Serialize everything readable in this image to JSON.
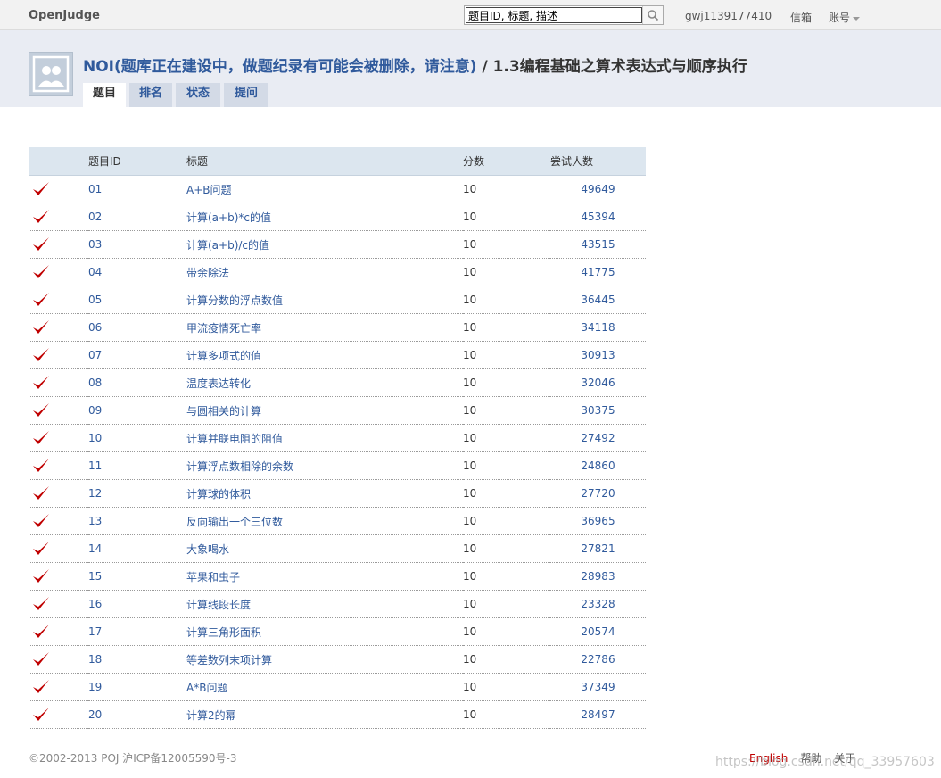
{
  "topbar": {
    "brand": "OpenJudge",
    "search_value": "题目ID, 标题, 描述",
    "user": "gwj1139177410",
    "inbox": "信箱",
    "account": "账号"
  },
  "header": {
    "group_title": "NOI(题库正在建设中，做题纪录有可能会被删除，请注意)",
    "separator": " / ",
    "section_title": "1.3编程基础之算术表达式与顺序执行",
    "tabs": [
      {
        "label": "题目",
        "active": true
      },
      {
        "label": "排名",
        "active": false
      },
      {
        "label": "状态",
        "active": false
      },
      {
        "label": "提问",
        "active": false
      }
    ]
  },
  "table": {
    "columns": [
      "",
      "题目ID",
      "标题",
      "分数",
      "尝试人数"
    ],
    "rows": [
      {
        "solved": true,
        "id": "01",
        "title": "A+B问题",
        "score": "10",
        "tries": "49649"
      },
      {
        "solved": true,
        "id": "02",
        "title": "计算(a+b)*c的值",
        "score": "10",
        "tries": "45394"
      },
      {
        "solved": true,
        "id": "03",
        "title": "计算(a+b)/c的值",
        "score": "10",
        "tries": "43515"
      },
      {
        "solved": true,
        "id": "04",
        "title": "带余除法",
        "score": "10",
        "tries": "41775"
      },
      {
        "solved": true,
        "id": "05",
        "title": "计算分数的浮点数值",
        "score": "10",
        "tries": "36445"
      },
      {
        "solved": true,
        "id": "06",
        "title": "甲流疫情死亡率",
        "score": "10",
        "tries": "34118"
      },
      {
        "solved": true,
        "id": "07",
        "title": "计算多项式的值",
        "score": "10",
        "tries": "30913"
      },
      {
        "solved": true,
        "id": "08",
        "title": "温度表达转化",
        "score": "10",
        "tries": "32046"
      },
      {
        "solved": true,
        "id": "09",
        "title": "与圆相关的计算",
        "score": "10",
        "tries": "30375"
      },
      {
        "solved": true,
        "id": "10",
        "title": "计算并联电阻的阻值",
        "score": "10",
        "tries": "27492"
      },
      {
        "solved": true,
        "id": "11",
        "title": "计算浮点数相除的余数",
        "score": "10",
        "tries": "24860"
      },
      {
        "solved": true,
        "id": "12",
        "title": "计算球的体积",
        "score": "10",
        "tries": "27720"
      },
      {
        "solved": true,
        "id": "13",
        "title": "反向输出一个三位数",
        "score": "10",
        "tries": "36965"
      },
      {
        "solved": true,
        "id": "14",
        "title": "大象喝水",
        "score": "10",
        "tries": "27821"
      },
      {
        "solved": true,
        "id": "15",
        "title": "苹果和虫子",
        "score": "10",
        "tries": "28983"
      },
      {
        "solved": true,
        "id": "16",
        "title": "计算线段长度",
        "score": "10",
        "tries": "23328"
      },
      {
        "solved": true,
        "id": "17",
        "title": "计算三角形面积",
        "score": "10",
        "tries": "20574"
      },
      {
        "solved": true,
        "id": "18",
        "title": "等差数列末项计算",
        "score": "10",
        "tries": "22786"
      },
      {
        "solved": true,
        "id": "19",
        "title": "A*B问题",
        "score": "10",
        "tries": "37349"
      },
      {
        "solved": true,
        "id": "20",
        "title": "计算2的幂",
        "score": "10",
        "tries": "28497"
      }
    ]
  },
  "footer": {
    "copyright": "©2002-2013 POJ 沪ICP备12005590号-3",
    "links": [
      "English",
      "帮助",
      "关于"
    ],
    "watermark": "https://blog.csdn.net/qq_33957603"
  },
  "colors": {
    "link": "#305a9c",
    "check": "#c00000",
    "header_band": "#e9ecf3",
    "table_header": "#dce6ef"
  }
}
